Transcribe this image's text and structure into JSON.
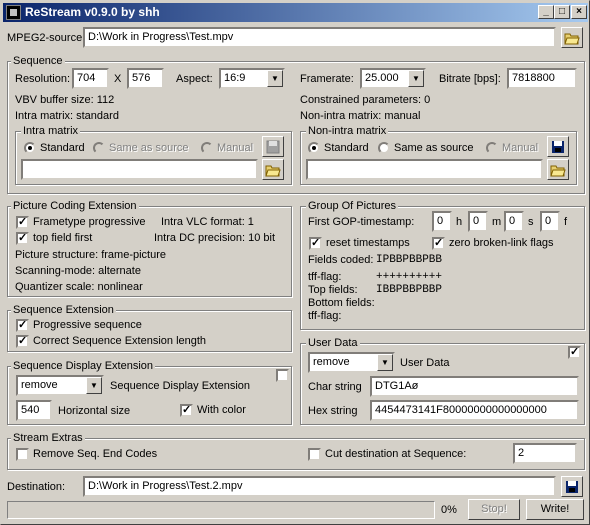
{
  "window": {
    "title": "ReStream v0.9.0 by shh",
    "min": "_",
    "max": "□",
    "close": "×"
  },
  "source": {
    "label": "MPEG2-source:",
    "path": "D:\\Work in Progress\\Test.mpv"
  },
  "sequence": {
    "title": "Sequence",
    "resolution_label": "Resolution:",
    "width": "704",
    "x": "X",
    "height": "576",
    "aspect_label": "Aspect:",
    "aspect": "16:9",
    "framerate_label": "Framerate:",
    "framerate": "25.000",
    "bitrate_label": "Bitrate [bps]:",
    "bitrate": "7818800",
    "vbv": "VBV buffer size: 112",
    "constrained": "Constrained parameters: 0",
    "intra_matrix_line": "Intra matrix: standard",
    "non_intra_matrix_line": "Non-intra matrix: manual",
    "intra": {
      "title": "Intra matrix",
      "standard": "Standard",
      "same": "Same as source",
      "manual": "Manual",
      "value": ""
    },
    "non_intra": {
      "title": "Non-intra matrix",
      "standard": "Standard",
      "same": "Same as source",
      "manual": "Manual",
      "value": ""
    }
  },
  "pce": {
    "title": "Picture Coding Extension",
    "frametype": "Frametype progressive",
    "frametype_checked": "✓",
    "vlc": "Intra VLC format: 1",
    "topfield": "top field first",
    "topfield_checked": "✓",
    "dc": "Intra DC precision: 10 bit",
    "structure": "Picture structure: frame-picture",
    "scanning": "Scanning-mode: alternate",
    "quantizer": "Quantizer scale: nonlinear"
  },
  "seqext": {
    "title": "Sequence Extension",
    "progressive": "Progressive sequence",
    "progressive_checked": "✓",
    "correct": "Correct Sequence Extension length",
    "correct_checked": "✓"
  },
  "sde": {
    "title": "Sequence Display Extension",
    "mode": "remove",
    "label": "Sequence Display Extension",
    "hsize": "540",
    "hsize_label": "Horizontal size",
    "withcolor": "With color",
    "withcolor_checked": "✓"
  },
  "gop": {
    "title": "Group Of Pictures",
    "timestamp_label": "First GOP-timestamp:",
    "h": "0",
    "h_unit": "h",
    "m": "0",
    "m_unit": "m",
    "s": "0",
    "s_unit": "s",
    "f": "0",
    "f_unit": "f",
    "reset": "reset timestamps",
    "reset_checked": "✓",
    "zero": "zero broken-link flags",
    "zero_checked": "✓",
    "fields_coded_label": "Fields coded:",
    "fields_coded": "IPBBPBBPBB",
    "tff_label": "tff-flag:",
    "tff": "++++++++++",
    "top_label": "Top fields:",
    "top": "IBBPBBPBBP",
    "bottom_label": "Bottom fields:",
    "tff2_label": "tff-flag:"
  },
  "userdata": {
    "title": "User Data",
    "mode": "remove",
    "label": "User Data",
    "checked": "✓",
    "char_label": "Char string",
    "char": "DTG1Aø",
    "hex_label": "Hex string",
    "hex": "4454473141F80000000000000000"
  },
  "extras": {
    "title": "Stream Extras",
    "remove_end": "Remove Seq. End Codes",
    "cut": "Cut destination at Sequence:",
    "cut_value": "2"
  },
  "destination": {
    "label": "Destination:",
    "path": "D:\\Work in Progress\\Test.2.mpv"
  },
  "status": {
    "progress": "0%",
    "progress_fraction": 0,
    "stop": "Stop!",
    "write": "Write!"
  }
}
